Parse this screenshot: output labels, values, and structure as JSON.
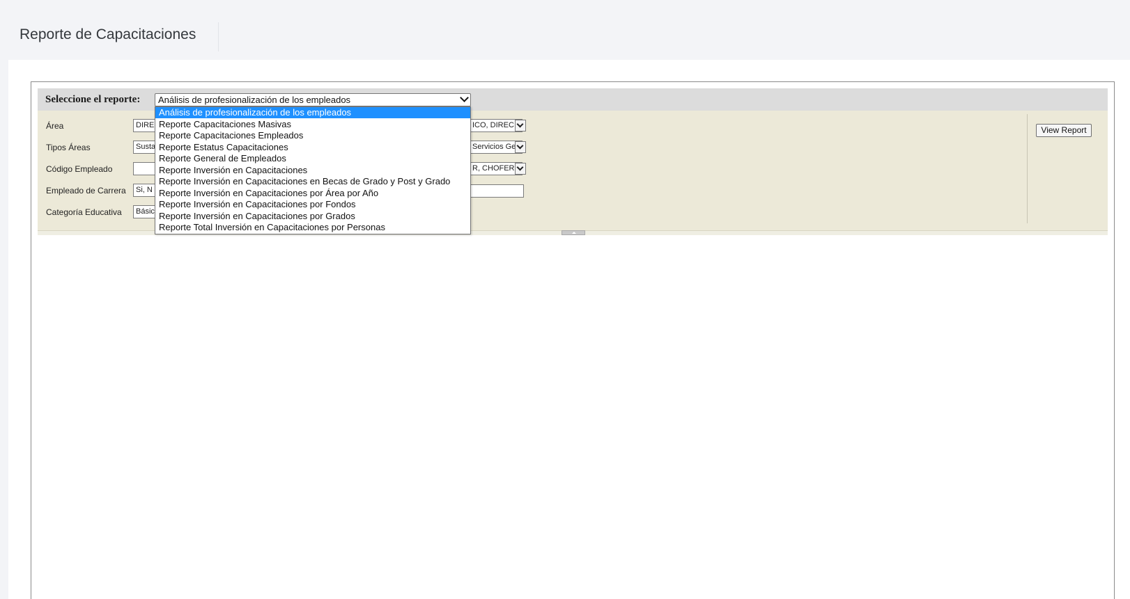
{
  "page": {
    "title": "Reporte de Capacitaciones"
  },
  "report_selector": {
    "label": "Seleccione el reporte:",
    "selected": "Análisis de profesionalización de los empleados",
    "options": [
      "Análisis de profesionalización de los empleados",
      "Reporte Capacitaciones Masivas",
      "Reporte Capacitaciones Empleados",
      "Reporte Estatus Capacitaciones",
      "Reporte General de Empleados",
      "Reporte Inversión en Capacitaciones",
      "Reporte Inversión en Capacitaciones en Becas de Grado y Post y Grado",
      "Reporte Inversión en Capacitaciones por Área por Año",
      "Reporte Inversión en Capacitaciones por Fondos",
      "Reporte Inversión en Capacitaciones por Grados",
      "Reporte Total Inversión en Capacitaciones por Personas"
    ]
  },
  "parameters": {
    "area": {
      "label": "Área",
      "value": "DIRE",
      "right_value": "ICO, DIREC"
    },
    "tipos_areas": {
      "label": "Tipos Áreas",
      "value": "Susta",
      "right_value": "Servicios Ge"
    },
    "codigo_empleado": {
      "label": "Código Empleado",
      "value": "",
      "right_value": "R, CHOFER"
    },
    "empleado_carrera": {
      "label": "Empleado de Carrera",
      "value": "Si, N"
    },
    "categoria_educativa": {
      "label": "Categoría Educativa",
      "value": "Básic"
    }
  },
  "toolbar": {
    "view_report_label": "View Report"
  }
}
